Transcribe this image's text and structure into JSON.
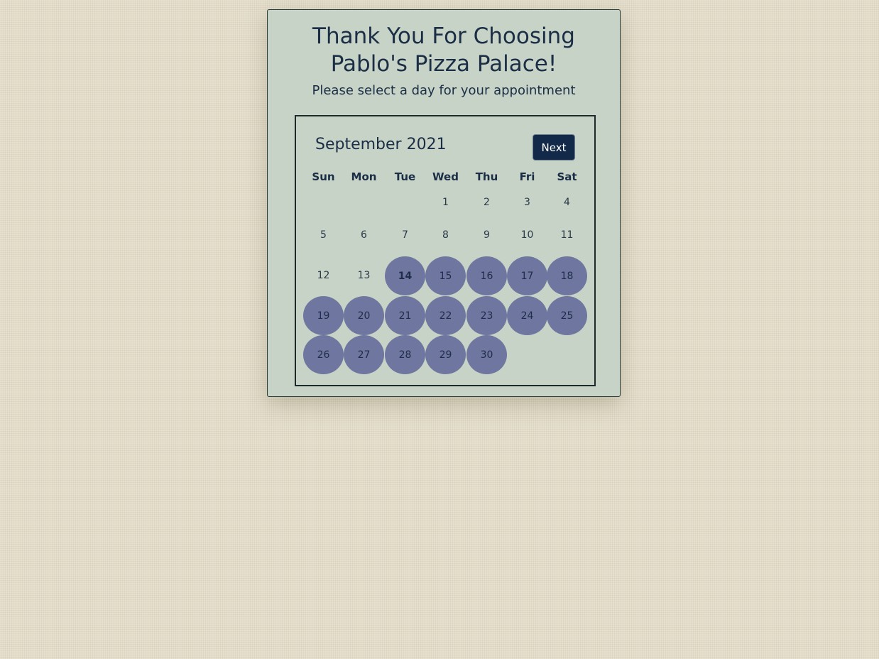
{
  "header": {
    "title_line1": "Thank You For Choosing",
    "title_line2": "Pablo's Pizza Palace!",
    "subtitle": "Please select a day for your appointment"
  },
  "calendar": {
    "month_label": "September 2021",
    "next_label": "Next",
    "weekdays": [
      "Sun",
      "Mon",
      "Tue",
      "Wed",
      "Thu",
      "Fri",
      "Sat"
    ],
    "first_weekday_index": 3,
    "days_in_month": 30,
    "today": 14,
    "available_from": 14,
    "available_color": "#6f769f"
  }
}
